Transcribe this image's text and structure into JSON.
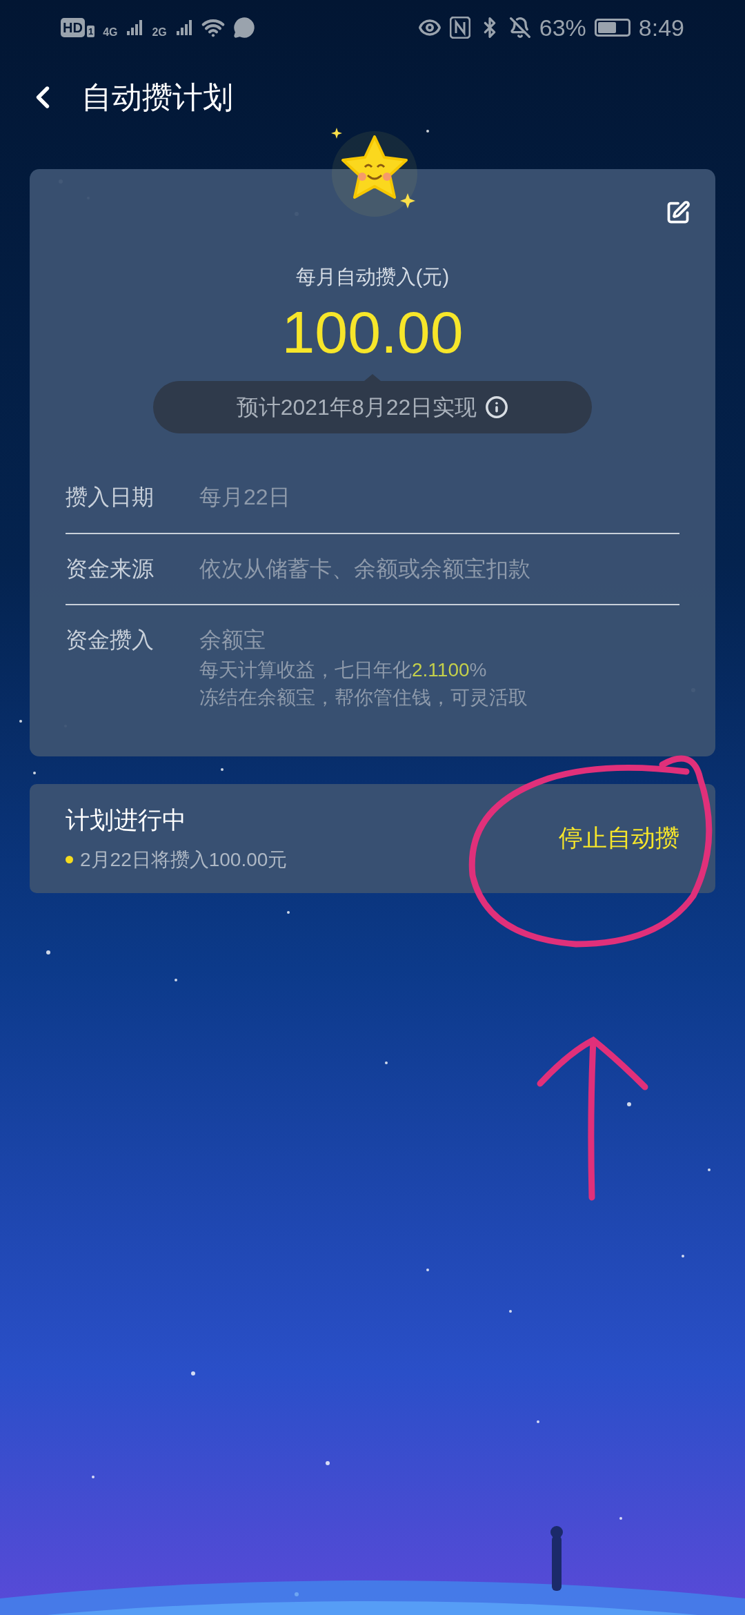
{
  "status_bar": {
    "hd": "HD",
    "sim": "1",
    "network_1": "4G",
    "network_2": "2G",
    "battery": "63%",
    "time": "8:49"
  },
  "header": {
    "title": "自动攒计划"
  },
  "plan_card": {
    "amount_label": "每月自动攒入(元)",
    "amount": "100.00",
    "forecast": "预计2021年8月22日实现",
    "rows": [
      {
        "label": "攒入日期",
        "lines": [
          {
            "parts": [
              "每月22日"
            ]
          }
        ]
      },
      {
        "label": "资金来源",
        "lines": [
          {
            "parts": [
              "依次从储蓄卡、余额或余额宝扣款"
            ]
          }
        ]
      },
      {
        "label": "资金攒入",
        "lines": [
          {
            "parts": [
              "余额宝"
            ]
          },
          {
            "parts": [
              "每天计算收益，七日年化",
              "2.1100",
              "%"
            ]
          },
          {
            "parts": [
              "冻结在余额宝，帮你管住钱，可灵活取"
            ]
          }
        ]
      }
    ]
  },
  "status_card": {
    "title": "计划进行中",
    "note": "2月22日将攒入100.00元",
    "stop_button": "停止自动攒"
  }
}
